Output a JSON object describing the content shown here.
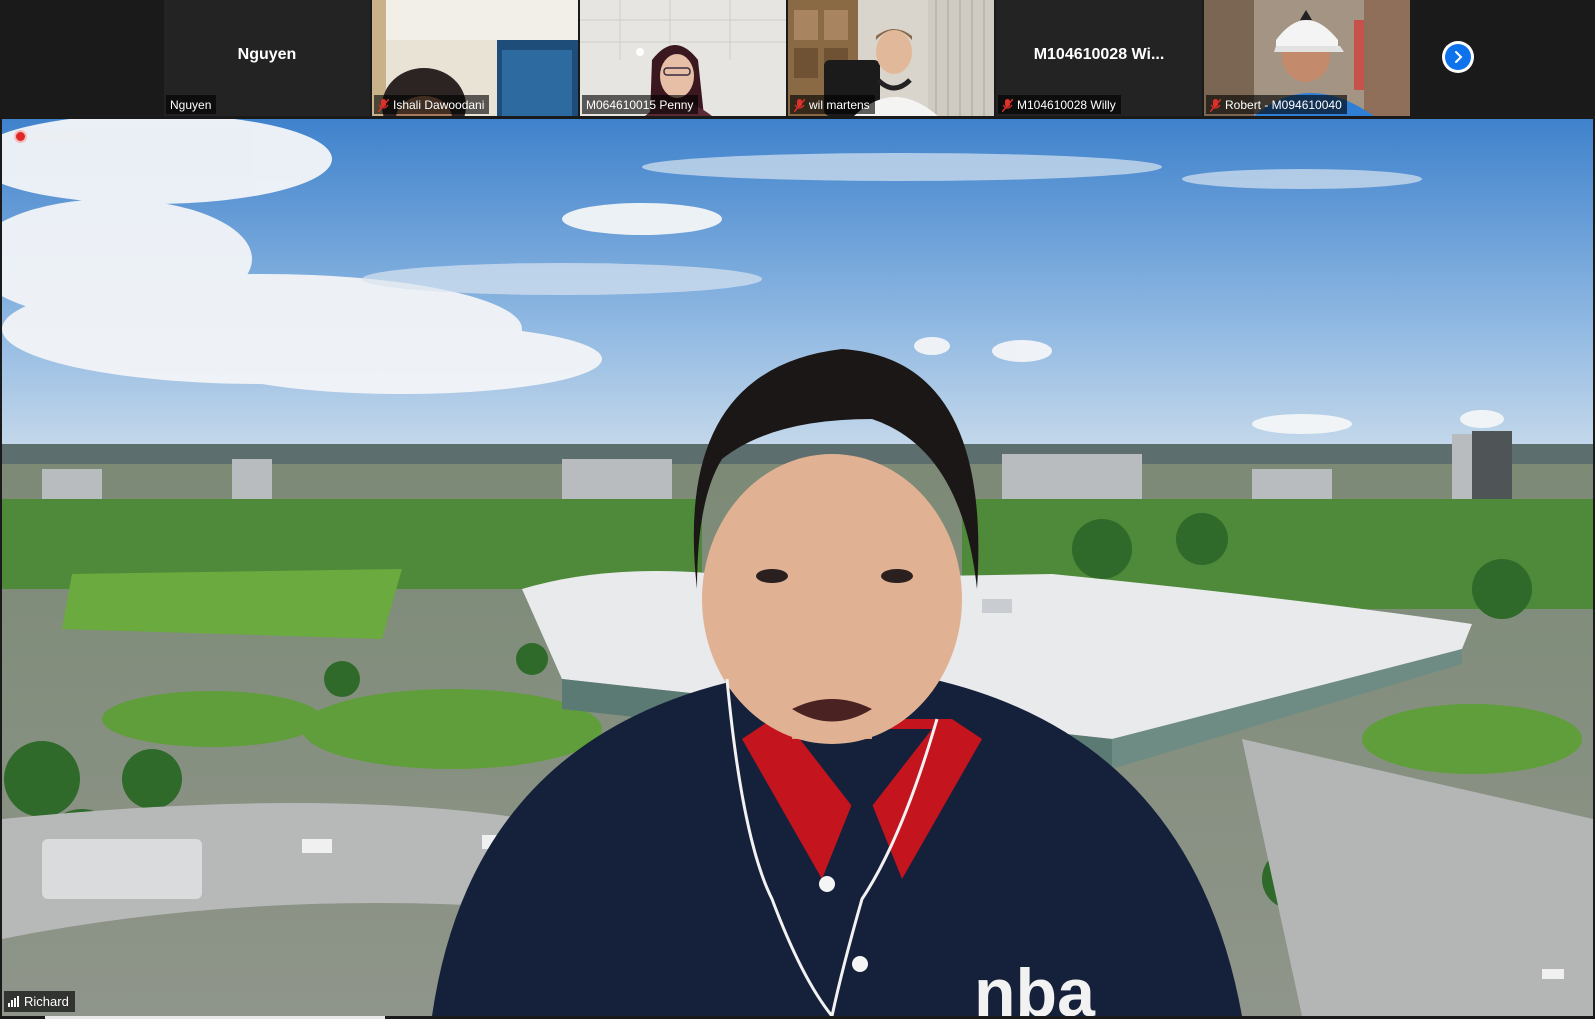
{
  "gallery": {
    "tiles": [
      {
        "center_name": "Nguyen",
        "tag": "Nguyen",
        "muted": false,
        "video": false
      },
      {
        "center_name": "",
        "tag": "Ishali Dawoodani",
        "muted": true,
        "video": true
      },
      {
        "center_name": "",
        "tag": "M064610015 Penny",
        "muted": false,
        "video": true
      },
      {
        "center_name": "",
        "tag": "wil martens",
        "muted": true,
        "video": true
      },
      {
        "center_name": "M104610028 Wi...",
        "tag": "M104610028 Willy",
        "muted": true,
        "video": false
      },
      {
        "center_name": "",
        "tag": "Robert - M094610040",
        "muted": true,
        "video": true
      }
    ],
    "next_icon": "chevron-right-icon"
  },
  "speaker": {
    "recording_label": "Recording",
    "name": "Richard",
    "shirt_text": "nba"
  },
  "colors": {
    "accent": "#0e72ed",
    "recording": "#e02828"
  }
}
